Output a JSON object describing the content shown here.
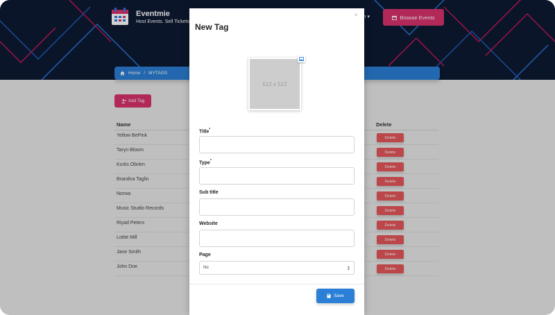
{
  "brand": {
    "name": "Eventmie",
    "tagline": "Host Events. Sell Tickets."
  },
  "header": {
    "language_label": "sh ▾",
    "browse_label": "Browse Events"
  },
  "breadcrumb": {
    "home": "Home",
    "separator": "/",
    "current": "MYTAGS"
  },
  "toolbar": {
    "add_tag_label": "Add Tag"
  },
  "table": {
    "headers": {
      "name": "Name",
      "delete": "Delete"
    },
    "rows": [
      {
        "name": "Yellow BePink",
        "action": "Delete"
      },
      {
        "name": "Taryn Bloom",
        "action": "Delete"
      },
      {
        "name": "Kurtis Obrien",
        "action": "Delete"
      },
      {
        "name": "Brandna Taglin",
        "action": "Delete"
      },
      {
        "name": "Norwa",
        "action": "Delete"
      },
      {
        "name": "Music Studio Records",
        "action": "Delete"
      },
      {
        "name": "Riyad Peters",
        "action": "Delete"
      },
      {
        "name": "Lottie Mill",
        "action": "Delete"
      },
      {
        "name": "Jane Smith",
        "action": "Delete"
      },
      {
        "name": "John Doe",
        "action": "Delete"
      }
    ]
  },
  "modal": {
    "title": "New Tag",
    "close": "×",
    "image_placeholder": "512 x 512",
    "fields": {
      "title": {
        "label": "Title",
        "required": "*",
        "value": ""
      },
      "type": {
        "label": "Type",
        "required": "*",
        "value": ""
      },
      "subtitle": {
        "label": "Sub title",
        "value": ""
      },
      "website": {
        "label": "Website",
        "value": ""
      },
      "page": {
        "label": "Page",
        "selected": "No"
      }
    },
    "save_label": "Save"
  },
  "colors": {
    "primary": "#2b7fd6",
    "accent": "#d9326d",
    "danger": "#e4575b",
    "header_bg": "#0e1a33"
  }
}
